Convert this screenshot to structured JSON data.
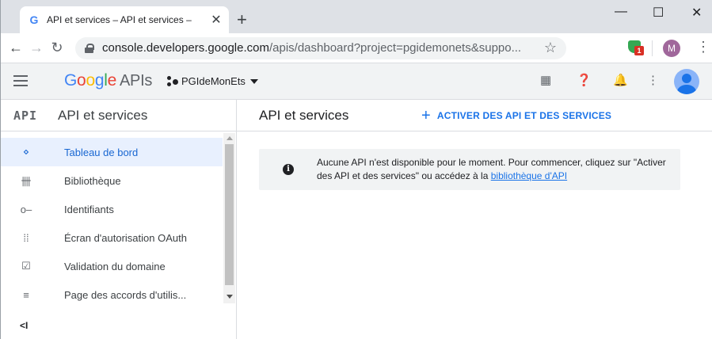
{
  "browser": {
    "tab_title": "API et services – API et services –",
    "tab_favicon": "G",
    "tab_close": "✕",
    "new_tab": "+",
    "minimize": "—",
    "maximize": "☐",
    "close": "✕",
    "url_host": "console.developers.google.com",
    "url_path": "/apis/dashboard?project=pgidemonets&suppo...",
    "extension_badge": "1",
    "profile_initial": "M"
  },
  "header": {
    "logo_google": [
      "G",
      "o",
      "o",
      "g",
      "l",
      "e"
    ],
    "logo_apis": "APIs",
    "project_name": "PGIdeMonEts"
  },
  "sidebar": {
    "logo": "API",
    "title": "API et services",
    "items": [
      {
        "icon": "dashboard-icon",
        "glyph": "⋄",
        "label": "Tableau de bord",
        "active": true
      },
      {
        "icon": "library-icon",
        "glyph": "卌",
        "label": "Bibliothèque",
        "active": false
      },
      {
        "icon": "key-icon",
        "glyph": "o‒",
        "label": "Identifiants",
        "active": false
      },
      {
        "icon": "consent-icon",
        "glyph": "⁞⁞",
        "label": "Écran d'autorisation OAuth",
        "active": false
      },
      {
        "icon": "checkbox-icon",
        "glyph": "☑",
        "label": "Validation du domaine",
        "active": false
      },
      {
        "icon": "settings-list-icon",
        "glyph": "≡",
        "label": "Page des accords d'utilis...",
        "active": false
      }
    ],
    "collapse_glyph": "<I"
  },
  "main": {
    "title": "API et services",
    "enable_button": "ACTIVER DES API ET DES SERVICES",
    "notice_text": "Aucune API n'est disponible pour le moment. Pour commencer, cliquez sur \"Activer des API et des services\" ou accédez à la",
    "notice_link": "bibliothèque d'API"
  },
  "colors": {
    "accent": "#1a73e8",
    "active_bg": "#e8f0fe"
  }
}
